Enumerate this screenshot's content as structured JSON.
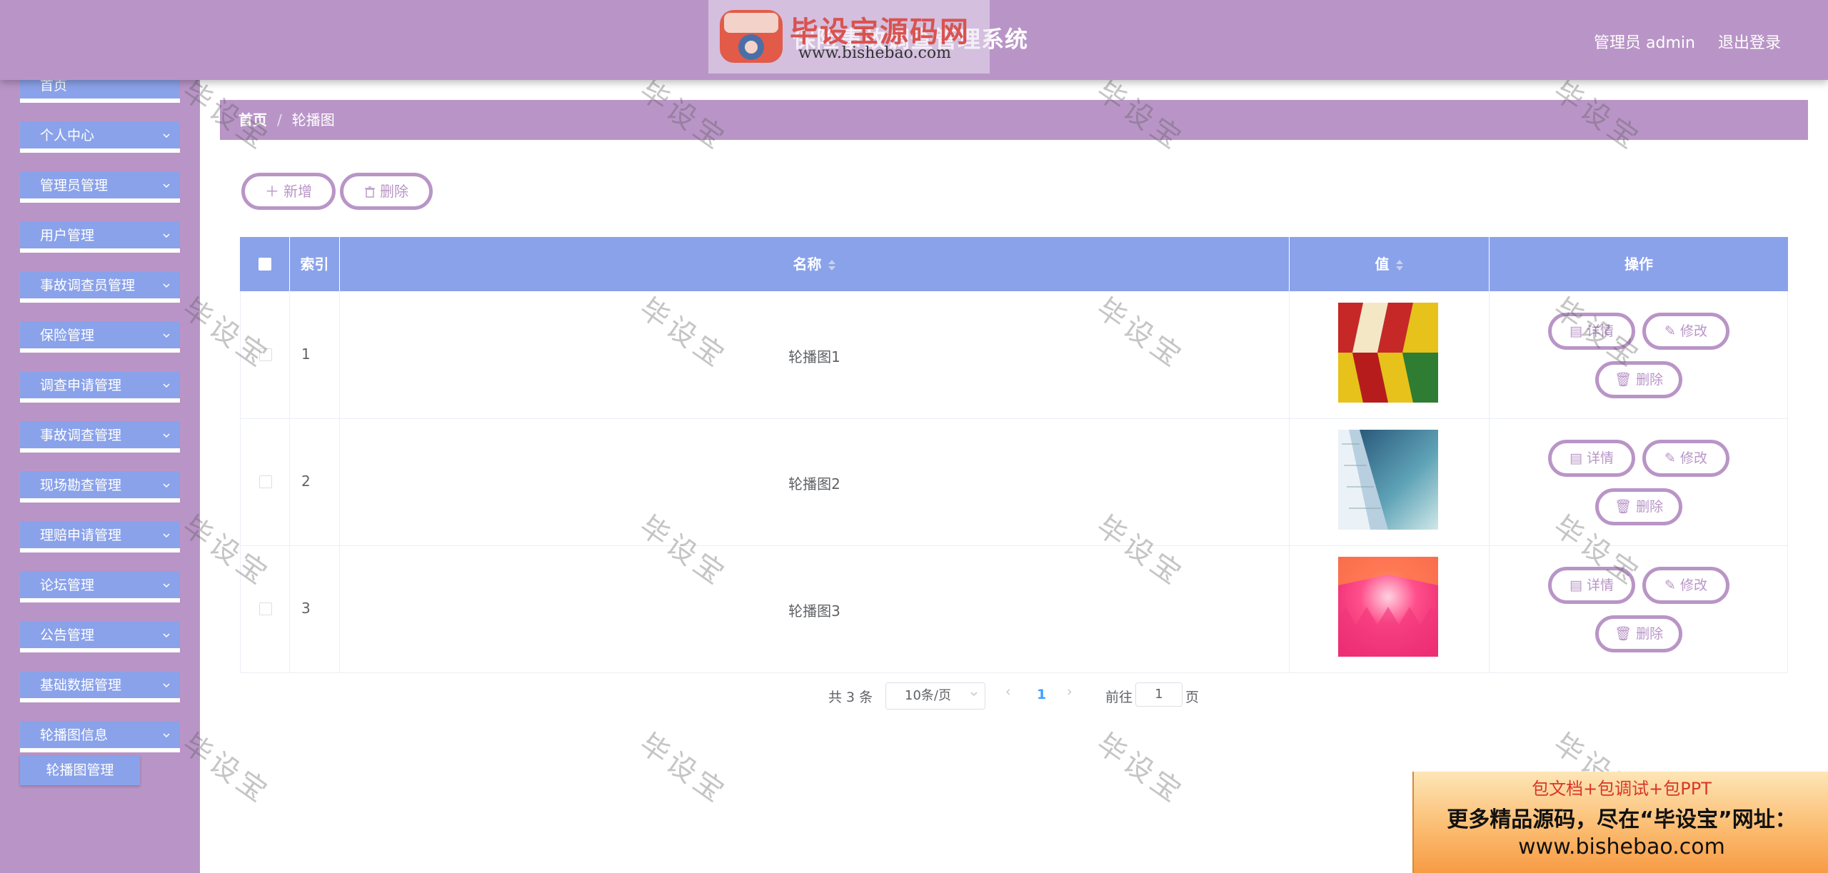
{
  "header": {
    "app_title": "保险事故调查管理系统",
    "user_label": "管理员 admin",
    "logout_label": "退出登录"
  },
  "logo": {
    "mark_text": "毕设宝",
    "name": "毕设宝源码网",
    "url": "www.bishebao.com"
  },
  "sidebar": {
    "items": [
      {
        "label": "首页"
      },
      {
        "label": "个人中心"
      },
      {
        "label": "管理员管理"
      },
      {
        "label": "用户管理"
      },
      {
        "label": "事故调查员管理"
      },
      {
        "label": "保险管理"
      },
      {
        "label": "调查申请管理"
      },
      {
        "label": "事故调查管理"
      },
      {
        "label": "现场勘查管理"
      },
      {
        "label": "理赔申请管理"
      },
      {
        "label": "论坛管理"
      },
      {
        "label": "公告管理"
      },
      {
        "label": "基础数据管理"
      },
      {
        "label": "轮播图信息"
      }
    ],
    "submenu": {
      "label": "轮播图管理"
    }
  },
  "breadcrumb": {
    "home": "首页",
    "separator": "/",
    "current": "轮播图"
  },
  "toolbar": {
    "add_label": "新增",
    "delete_label": "删除"
  },
  "table": {
    "columns": {
      "index": "索引",
      "name": "名称",
      "value": "值",
      "actions": "操作"
    },
    "rows": [
      {
        "index": "1",
        "name": "轮播图1",
        "image": "colorful-zigzag-pattern"
      },
      {
        "index": "2",
        "name": "轮播图2",
        "image": "skyscraper-photo"
      },
      {
        "index": "3",
        "name": "轮播图3",
        "image": "pink-abstract-pattern"
      }
    ],
    "row_actions": {
      "detail": "详情",
      "edit": "修改",
      "delete": "删除"
    }
  },
  "pagination": {
    "total": "共 3 条",
    "page_size": "10条/页",
    "current_page": "1",
    "goto_prefix": "前往",
    "goto_value": "1",
    "goto_suffix": "页"
  },
  "watermark": {
    "text": "毕设宝"
  },
  "ad": {
    "line1": "包文档+包调试+包PPT",
    "line2": "更多精品源码，尽在“毕设宝”网址：",
    "line3": "www.bishebao.com"
  },
  "colors": {
    "primary": "#b995c7",
    "menu_blue": "#8aa2ea",
    "page_active": "#409eff"
  }
}
